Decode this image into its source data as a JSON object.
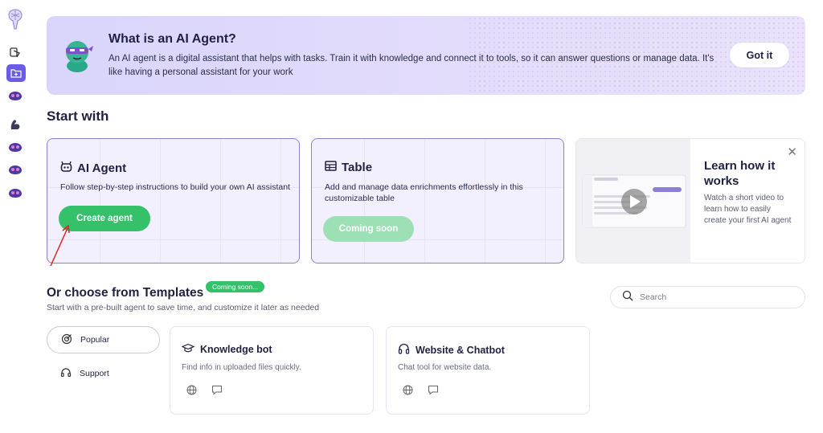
{
  "banner": {
    "title": "What is an AI Agent?",
    "text": "An AI agent is a digital assistant that helps with tasks. Train it with knowledge and connect it to tools, so it can answer questions or manage data. It's like having a personal assistant for your work",
    "button": "Got it"
  },
  "start": {
    "title": "Start with",
    "ai_agent": {
      "title": "AI Agent",
      "desc": "Follow step-by-step instructions to build your own AI assistant",
      "button": "Create agent"
    },
    "table": {
      "title": "Table",
      "desc": "Add and manage data enrichments effortlessly in this customizable table",
      "button": "Coming soon"
    },
    "learn": {
      "title": "Learn how it works",
      "desc": "Watch a short video to learn how to easily create your first AI agent"
    }
  },
  "templates": {
    "title": "Or choose from Templates",
    "badge": "Coming soon...",
    "subtitle": "Start with a pre-built agent to save time, and customize it later as needed",
    "search_placeholder": "Search",
    "categories": [
      {
        "label": "Popular",
        "icon": "target-icon"
      },
      {
        "label": "Support",
        "icon": "headset-icon"
      }
    ],
    "cards": [
      {
        "title": "Knowledge bot",
        "desc": "Find info in uploaded files quickly.",
        "icon": "graduation-cap-icon"
      },
      {
        "title": "Website & Chatbot",
        "desc": "Chat tool for website data.",
        "icon": "headphones-icon"
      }
    ]
  },
  "colors": {
    "accent": "#6b5ce7",
    "green": "#34c16a",
    "card_border": "#8b7fd6"
  }
}
